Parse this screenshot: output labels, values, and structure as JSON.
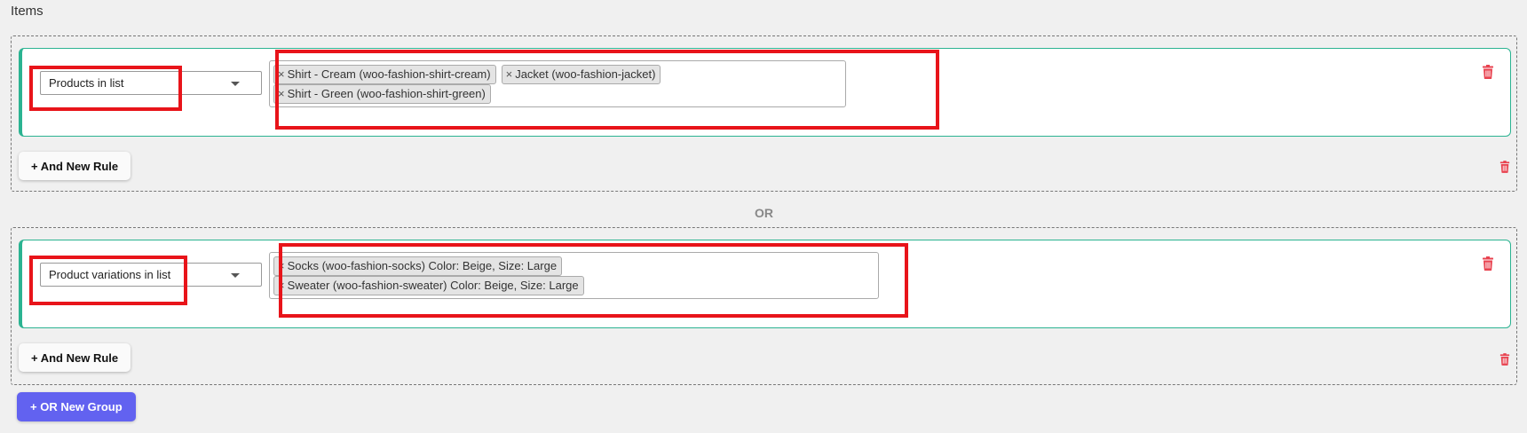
{
  "section_title": "Items",
  "or_label": "OR",
  "colors": {
    "rule_border": "#2bb391",
    "or_group_button": "#6262f0",
    "delete_icon": "#e8424f",
    "highlight": "#e8141a"
  },
  "groups": [
    {
      "rules": [
        {
          "condition": "Products in list",
          "tags": [
            "Shirt - Cream (woo-fashion-shirt-cream)",
            "Jacket (woo-fashion-jacket)",
            "Shirt - Green (woo-fashion-shirt-green)"
          ]
        }
      ],
      "and_button": "+ And New Rule"
    },
    {
      "rules": [
        {
          "condition": "Product variations in list",
          "tags": [
            "Socks (woo-fashion-socks) Color: Beige, Size: Large",
            "Sweater (woo-fashion-sweater) Color: Beige, Size: Large"
          ]
        }
      ],
      "and_button": "+ And New Rule"
    }
  ],
  "or_group_button": "+ OR New Group",
  "tag_remove_symbol": "×"
}
